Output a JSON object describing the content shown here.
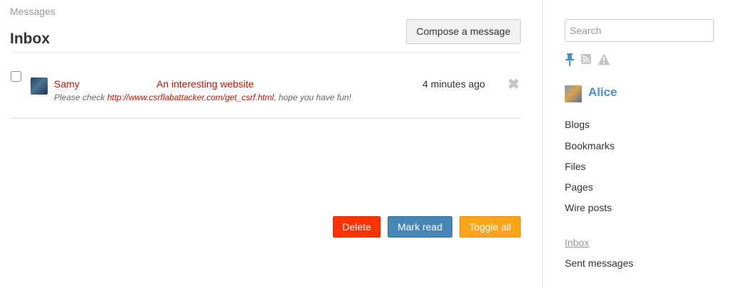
{
  "breadcrumb": "Messages",
  "title": "Inbox",
  "compose_label": "Compose a message",
  "messages": [
    {
      "sender": "Samy",
      "subject": "An interesting website",
      "time": "4 minutes ago",
      "excerpt_before": "Please check ",
      "excerpt_link": "http://www.csrflabattacker.com/get_csrf.html",
      "excerpt_after": ", hope you have fun!"
    }
  ],
  "actions": {
    "delete": "Delete",
    "mark_read": "Mark read",
    "toggle_all": "Toggle all"
  },
  "sidebar": {
    "search_placeholder": "Search",
    "owner_name": "Alice",
    "links": [
      "Blogs",
      "Bookmarks",
      "Files",
      "Pages",
      "Wire posts"
    ],
    "message_links": [
      "Inbox",
      "Sent messages"
    ]
  },
  "colors": {
    "link_red": "#cc1100",
    "accent_blue": "#4690d6",
    "delete_btn": "#ff3300",
    "mark_read_btn": "#4787b8",
    "toggle_all_btn": "#faa51a"
  },
  "icons": [
    "checkbox",
    "avatar",
    "delete-x-icon",
    "pin-icon",
    "rss-icon",
    "warning-icon"
  ]
}
